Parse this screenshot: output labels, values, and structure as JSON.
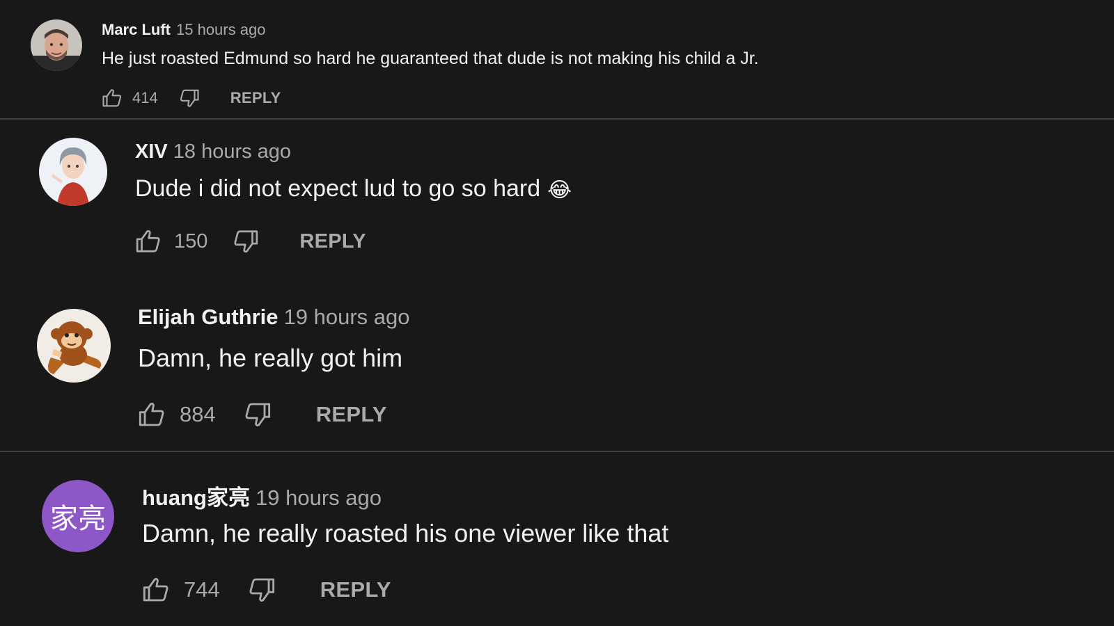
{
  "comments": [
    {
      "author": "Marc Luft",
      "time": "15 hours ago",
      "text": "He just roasted Edmund so hard he guaranteed that dude is not making his child a Jr.",
      "likes": "414",
      "reply_label": "REPLY",
      "avatar": "photo-avatar"
    },
    {
      "author": "XIV",
      "time": "18 hours ago",
      "text": "Dude i did not expect lud to go so hard",
      "emoji": "😂",
      "likes": "150",
      "reply_label": "REPLY",
      "avatar": "anime-avatar"
    },
    {
      "author": "Elijah Guthrie",
      "time": "19 hours ago",
      "text": "Damn, he really got him",
      "likes": "884",
      "reply_label": "REPLY",
      "avatar": "monkey-avatar"
    },
    {
      "author": "huang家亮",
      "time": "19 hours ago",
      "text": "Damn, he really roasted his one viewer like that",
      "likes": "744",
      "reply_label": "REPLY",
      "avatar_initials": "家亮",
      "avatar_color": "#8e57c8"
    }
  ],
  "colors": {
    "background": "#181818",
    "author": "#f1f1f1",
    "secondary": "#aaaaaa",
    "divider": "#3f3f3f"
  },
  "icons": [
    "thumb-up-icon",
    "thumb-down-icon"
  ]
}
